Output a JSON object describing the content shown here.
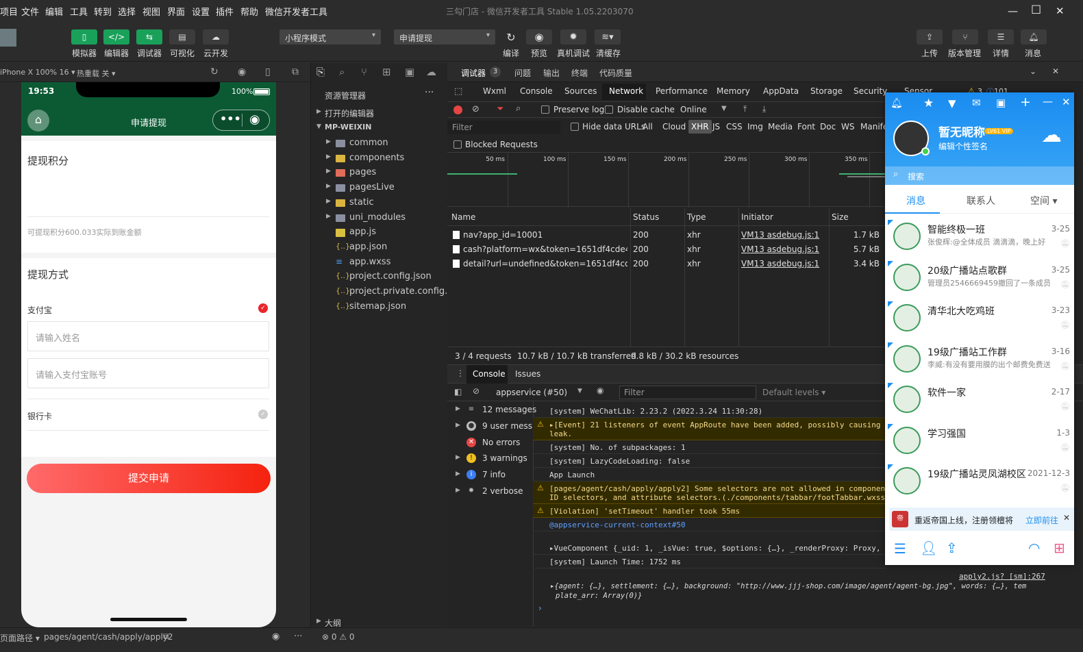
{
  "menubar": {
    "items": [
      "项目",
      "文件",
      "编辑",
      "工具",
      "转到",
      "选择",
      "视图",
      "界面",
      "设置",
      "插件",
      "帮助",
      "微信开发者工具"
    ],
    "title": "三勾门店 - 微信开发者工具 Stable 1.05.2203070"
  },
  "toolbar": {
    "left_buttons": [
      "模拟器",
      "编辑器",
      "调试器",
      "可视化",
      "云开发"
    ],
    "mode_select": "小程序模式",
    "page_select": "申请提现",
    "mid_buttons": [
      "编译",
      "预览",
      "真机调试",
      "清缓存"
    ],
    "right_buttons": [
      "上传",
      "版本管理",
      "详情",
      "消息"
    ]
  },
  "simbar": {
    "device": "iPhone X 100% 16 ▾",
    "hotreload": "热重载 关 ▾"
  },
  "phone": {
    "time": "19:53",
    "battery": "100%",
    "nav_title": "申请提现",
    "withdraw_points_label": "提现积分",
    "available_hint": "可提现积分600.033实际到账金额",
    "method_label": "提现方式",
    "alipay_label": "支付宝",
    "name_placeholder": "请输入姓名",
    "account_placeholder": "请输入支付宝账号",
    "bank_label": "银行卡",
    "submit": "提交申请"
  },
  "explorer": {
    "title": "资源管理器",
    "open_editors": "打开的编辑器",
    "root": "MP-WEIXIN",
    "items": [
      {
        "name": "common",
        "kind": "folder"
      },
      {
        "name": "components",
        "kind": "folder-yellow"
      },
      {
        "name": "pages",
        "kind": "folder-red"
      },
      {
        "name": "pagesLive",
        "kind": "folder"
      },
      {
        "name": "static",
        "kind": "folder-yellow"
      },
      {
        "name": "uni_modules",
        "kind": "folder"
      },
      {
        "name": "app.js",
        "kind": "js"
      },
      {
        "name": "app.json",
        "kind": "json"
      },
      {
        "name": "app.wxss",
        "kind": "wxss"
      },
      {
        "name": "project.config.json",
        "kind": "json"
      },
      {
        "name": "project.private.config.js...",
        "kind": "json"
      },
      {
        "name": "sitemap.json",
        "kind": "json"
      }
    ],
    "outline": "大纲"
  },
  "devtools": {
    "top_tabs": [
      "调试器",
      "问题",
      "输出",
      "终端",
      "代码质量"
    ],
    "debugger_count": "3",
    "panel_tabs": [
      "Wxml",
      "Console",
      "Sources",
      "Network",
      "Performance",
      "Memory",
      "AppData",
      "Storage",
      "Security",
      "Sensor"
    ],
    "warn_count": "3",
    "info_count": "101",
    "preserve_log": "Preserve log",
    "disable_cache": "Disable cache",
    "throttle": "Online",
    "filter_placeholder": "Filter",
    "hide_data_urls": "Hide data URLs",
    "type_filters": [
      "All",
      "Cloud",
      "XHR",
      "JS",
      "CSS",
      "Img",
      "Media",
      "Font",
      "Doc",
      "WS",
      "Manifest"
    ],
    "blocked_requests": "Blocked Requests",
    "timeline_ticks": [
      "50 ms",
      "100 ms",
      "150 ms",
      "200 ms",
      "250 ms",
      "300 ms",
      "350 ms"
    ],
    "columns": [
      "Name",
      "Status",
      "Type",
      "Initiator",
      "Size"
    ],
    "requests": [
      {
        "name": "nav?app_id=10001",
        "status": "200",
        "type": "xhr",
        "initiator": "VM13 asdebug.js:1",
        "size": "1.7 kB"
      },
      {
        "name": "cash?platform=wx&token=1651df4cde425...",
        "status": "200",
        "type": "xhr",
        "initiator": "VM13 asdebug.js:1",
        "size": "5.7 kB"
      },
      {
        "name": "detail?url=undefined&token=1651df4cde4...",
        "status": "200",
        "type": "xhr",
        "initiator": "VM13 asdebug.js:1",
        "size": "3.4 kB"
      }
    ],
    "summary": [
      "3 / 4 requests",
      "10.7 kB / 10.7 kB transferred",
      "9.8 kB / 30.2 kB resources"
    ],
    "console_tabs": [
      "Console",
      "Issues"
    ],
    "context": "appservice (#50)",
    "console_filter": "Filter",
    "levels": "Default levels ▾",
    "sidebar": [
      {
        "label": "12 messages",
        "icon": "list"
      },
      {
        "label": "9 user mess...",
        "icon": "user"
      },
      {
        "label": "No errors",
        "icon": "error"
      },
      {
        "label": "3 warnings",
        "icon": "warning"
      },
      {
        "label": "7 info",
        "icon": "info"
      },
      {
        "label": "2 verbose",
        "icon": "gear"
      }
    ],
    "messages": [
      {
        "text": "[system] WeChatLib: 2.23.2 (2022.3.24 11:30:28)",
        "level": "log"
      },
      {
        "text": "▸[Event] 21 listeners of event AppRoute have been added, possibly causing",
        "text2": "leak.",
        "level": "warn"
      },
      {
        "text": "[system] No. of subpackages: 1",
        "level": "log"
      },
      {
        "text": "[system] LazyCodeLoading: false",
        "level": "log"
      },
      {
        "text": "App Launch",
        "level": "log"
      },
      {
        "text": "[pages/agent/cash/apply/apply2] Some selectors are not allowed in component",
        "text2": "ID selectors, and attribute selectors.(./components/tabbar/footTabbar.wxss",
        "level": "warn"
      },
      {
        "text": "[Violation] 'setTimeout' handler took 55ms",
        "level": "warn"
      },
      {
        "text": "@appservice-current-context#50",
        "level": "link"
      },
      {
        "text": "▸VueComponent {_uid: 1, _isVue: true, $options: {…}, _renderProxy: Proxy, _",
        "level": "log"
      },
      {
        "text": "[system] Launch Time: 1752 ms",
        "level": "log"
      }
    ],
    "source_link": "apply2.js? [sm]:267",
    "object_line1": "▸{agent: {…}, settlement: {…}, background: \"http://www.jjj-shop.com/image/agent/agent-bg.jpg\", words: {…}, tem",
    "object_line2": "plate_arr: Array(0)}"
  },
  "qq": {
    "nickname": "暂无昵称",
    "signature": "编辑个性签名",
    "search": "搜索",
    "tabs": [
      "消息",
      "联系人",
      "空间 ▾"
    ],
    "chats": [
      {
        "name": "智能终极一班",
        "msg": "张俊辉:@全体成员 滴滴滴，晚上好",
        "date": "3-25"
      },
      {
        "name": "20级广播站点歌群",
        "msg": "管理员2546669459撤回了一条成员消息",
        "date": "3-25"
      },
      {
        "name": "清华北大吃鸡班",
        "msg": "",
        "date": "3-23"
      },
      {
        "name": "19级广播站工作群",
        "msg": "李威:有没有要用膜的出个邮费免费送",
        "date": "3-16"
      },
      {
        "name": "软件一家",
        "msg": "",
        "date": "2-17"
      },
      {
        "name": "学习强国",
        "msg": "",
        "date": "1-3"
      },
      {
        "name": "19级广播站灵凤湖校区",
        "msg": "",
        "date": "2021-12-3"
      }
    ],
    "banner": "重返帝国上线，注册领檀将",
    "banner_action": "立即前往"
  },
  "statusbar": {
    "path_label": "页面路径 ▾",
    "path": "pages/agent/cash/apply/apply2",
    "errors": "⊗ 0 ⚠ 0"
  }
}
